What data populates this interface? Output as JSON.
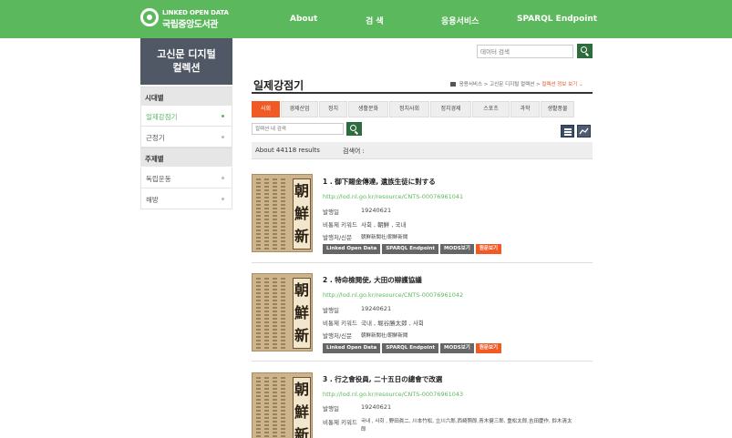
{
  "header": {
    "logo_en": "LINKED OPEN DATA",
    "logo_ko": "국립중앙도서관",
    "nav": [
      "About",
      "검 색",
      "응용서비스",
      "SPARQL Endpoint"
    ],
    "search_placeholder": "데이터 검색"
  },
  "sidebar": {
    "title_line1": "고신문 디지털",
    "title_line2": "컬렉션",
    "section1": "시대별",
    "items1": [
      "일제강점기",
      "근정기"
    ],
    "section2": "주제별",
    "items2": [
      "독립운동",
      "해방"
    ]
  },
  "main": {
    "title": "일제강점기",
    "breadcrumb": "응용서비스 > 고신문 디지털 컬렉션 >",
    "breadcrumb_current": "컬렉션 정보 보기",
    "tabs": [
      "사회",
      "경제산업",
      "정치",
      "생활문화",
      "정치사회",
      "정치경제",
      "스포츠",
      "과학",
      "생활풍물"
    ],
    "inner_search_placeholder": "컬렉션 내 검색",
    "results_text": "About 44118 results",
    "query_label": "검색어 :"
  },
  "labels": {
    "date": "발행일",
    "keywords": "비통제 키워드",
    "publisher": "발행처/신문",
    "btn_lod": "Linked Open Data",
    "btn_sparql": "SPARQL Endpoint",
    "btn_mods": "MODS보기",
    "btn_original": "원문보기"
  },
  "results": [
    {
      "title": "1 . 御下賜金傳達, 遺族生徒に對する",
      "uri": "http://lod.nl.go.kr/resource/CNTS-00076961041",
      "date": "19240621",
      "keywords": "사회 , 朝鮮 , 국내",
      "publisher": "朝鮮新聞社/朝鮮新聞",
      "masthead": "朝鮮新聞"
    },
    {
      "title": "2 . 特命檢閱使, 大田の辯護協議",
      "uri": "http://lod.nl.go.kr/resource/CNTS-00076961042",
      "date": "19240621",
      "keywords": "국내 , 堀谷勝太郎 , 사회",
      "publisher": "朝鮮新聞社/朝鮮新聞",
      "masthead": "朝鮮新聞"
    },
    {
      "title": "3 . 行之會役員, 二十五日の總會で改選",
      "uri": "http://lod.nl.go.kr/resource/CNTS-00076961043",
      "date": "19240621",
      "keywords": "국내 , 사회 , 野田眞二, 川本竹松, 立川六郎,西崎照郎,青木健三郎, 重松太郎,吉田慶作, 鈴木清太",
      "keywords_cont": "郎",
      "masthead": "朝鮮新聞"
    }
  ]
}
